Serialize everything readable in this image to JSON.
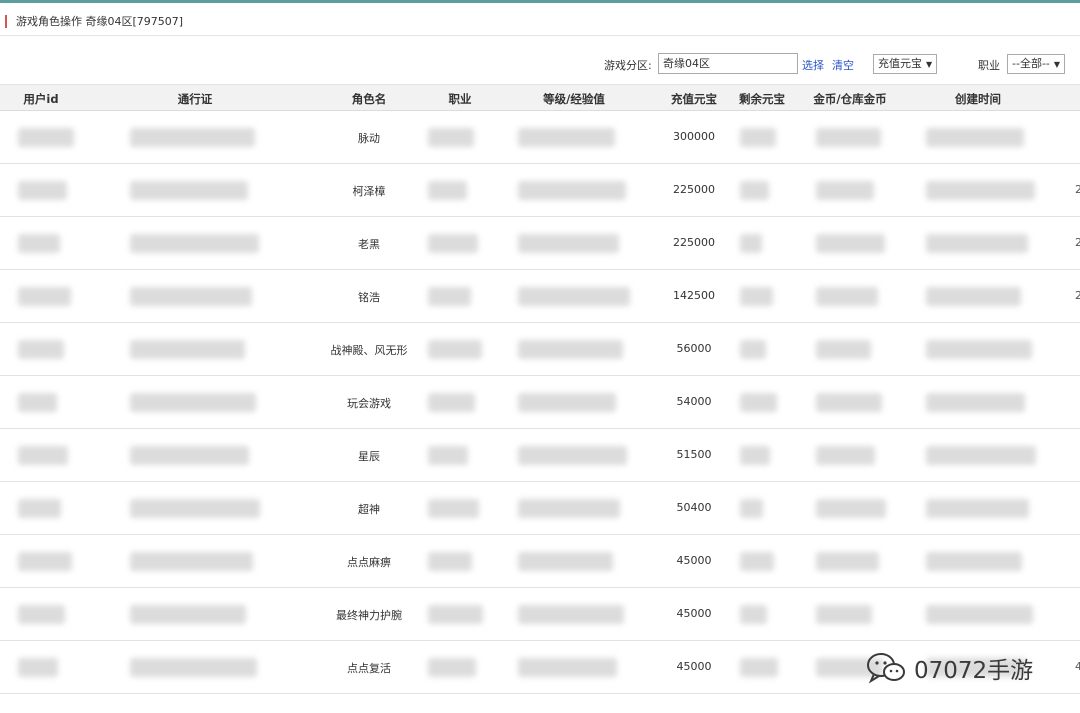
{
  "page_title": "游戏角色操作  奇缘04区[797507]",
  "filters": {
    "zone_label": "游戏分区:",
    "zone_value": "奇缘04区",
    "select_link": "选择",
    "clear_link": "清空",
    "sort_select": "充值元宝",
    "job_label": "职业",
    "job_select": "--全部--"
  },
  "columns": [
    "用户id",
    "通行证",
    "角色名",
    "职业",
    "等级/经验值",
    "充值元宝",
    "剩余元宝",
    "金币/仓库金币",
    "创建时间"
  ],
  "rows": [
    {
      "role_name": "脉动",
      "recharge": "300000"
    },
    {
      "role_name": "柯泽樟",
      "recharge": "225000"
    },
    {
      "role_name": "老黑",
      "recharge": "225000"
    },
    {
      "role_name": "铭浩",
      "recharge": "142500"
    },
    {
      "role_name": "战神殿、风无形",
      "recharge": "56000"
    },
    {
      "role_name": "玩会游戏",
      "recharge": "54000"
    },
    {
      "role_name": "星辰",
      "recharge": "51500"
    },
    {
      "role_name": "超神",
      "recharge": "50400"
    },
    {
      "role_name": "点点麻痹",
      "recharge": "45000"
    },
    {
      "role_name": "最终神力护腕",
      "recharge": "45000"
    },
    {
      "role_name": "点点复活",
      "recharge": "45000"
    }
  ],
  "edge_marks": [
    "2",
    "2",
    "2",
    "4"
  ],
  "watermark": {
    "icon": "wechat-icon",
    "text": "07072手游"
  },
  "colors": {
    "accent": "#d9534f",
    "link": "#2a55c9",
    "header_bg": "#f2f2f2"
  }
}
